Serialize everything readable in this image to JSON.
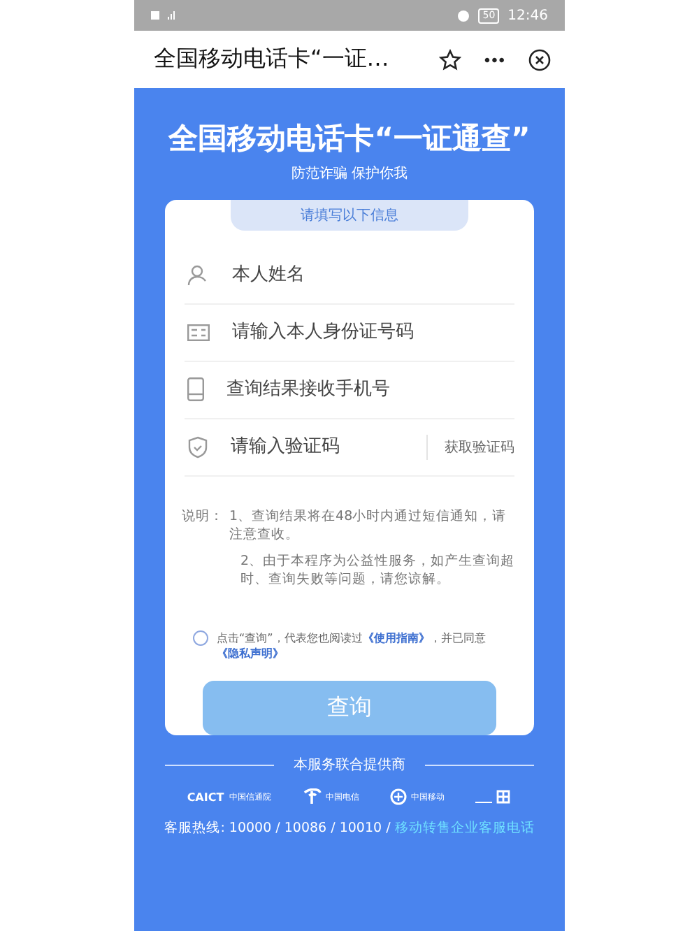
{
  "status_bar": {
    "time": "12:46",
    "battery": "50"
  },
  "title_bar": {
    "title": "全国移动电话卡“一证…",
    "menu": "•••"
  },
  "banner": {
    "title": "全国移动电话卡“一证通查”",
    "subtitle": "防范诈骗 保护你我"
  },
  "form": {
    "header": "请填写以下信息",
    "fields": [
      {
        "kind": "person",
        "placeholder": "本人姓名"
      },
      {
        "kind": "idcard",
        "placeholder": "请输入本人身份证号码"
      },
      {
        "kind": "phone",
        "placeholder": "查询结果接收手机号"
      },
      {
        "kind": "shield",
        "placeholder": "请输入验证码",
        "action": "获取验证码"
      }
    ],
    "notes_label": "说明：",
    "notes": [
      "1、查询结果将在48小时内通过短信通知，请注意查收。",
      "2、由于本程序为公益性服务，如产生查询超时、查询失败等问题，请您谅解。"
    ],
    "agreement": {
      "checked": false,
      "text_before": "点击“查询”，代表您也阅读过",
      "link1": "《使用指南》",
      "text_middle": "，并已同意",
      "link2": "《隐私声明》"
    },
    "submit": {
      "label": "查询",
      "disabled": true
    }
  },
  "footer": {
    "heading": "本服务联合提供商",
    "partners": [
      {
        "kind": "caict",
        "mark": "CAICT",
        "name": "中国信通院"
      },
      {
        "kind": "telecom",
        "name": "中国电信"
      },
      {
        "kind": "mobile",
        "name": "中国移动"
      },
      {
        "kind": "unicom"
      }
    ],
    "hotline_label": "客服热线: 10000 / 10086 / 10010 /",
    "hotline_link": "移动转售企业客服电话"
  }
}
